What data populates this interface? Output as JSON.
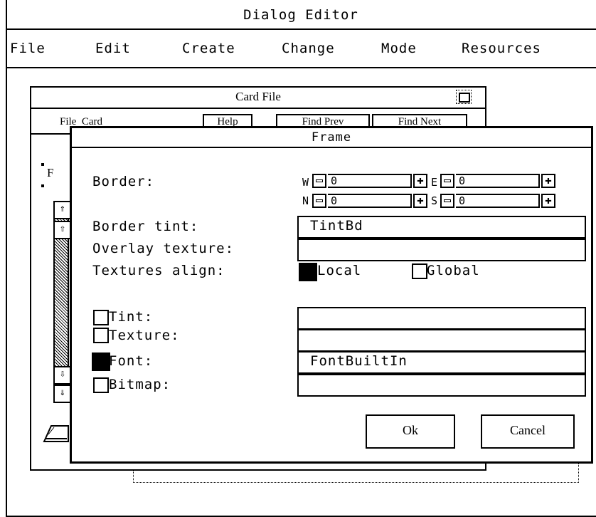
{
  "app": {
    "title": "Dialog Editor"
  },
  "menu": [
    "File",
    "Edit",
    "Create",
    "Change",
    "Mode",
    "Resources"
  ],
  "card_file": {
    "title": "Card File",
    "menu_left": "File  Card",
    "buttons": [
      "Help",
      "Find Prev",
      "Find Next"
    ],
    "field_prefix": "F"
  },
  "frame_dialog": {
    "title": "Frame",
    "border_label": "Border:",
    "border": {
      "W": {
        "label": "W",
        "value": "0"
      },
      "E": {
        "label": "E",
        "value": "0"
      },
      "N": {
        "label": "N",
        "value": "0"
      },
      "S": {
        "label": "S",
        "value": "0"
      }
    },
    "border_tint_label": "Border tint:",
    "border_tint_value": "TintBd",
    "overlay_texture_label": "Overlay texture:",
    "overlay_texture_value": "",
    "textures_align_label": "Textures align:",
    "align_local": {
      "label": "Local",
      "checked": true
    },
    "align_global": {
      "label": "Global",
      "checked": false
    },
    "tint": {
      "label": "Tint:",
      "checked": false,
      "value": ""
    },
    "texture": {
      "label": "Texture:",
      "checked": false,
      "value": ""
    },
    "font": {
      "label": "Font:",
      "checked": true,
      "value": "FontBuiltIn"
    },
    "bitmap": {
      "label": "Bitmap:",
      "checked": false,
      "value": ""
    },
    "ok_label": "Ok",
    "cancel_label": "Cancel"
  }
}
